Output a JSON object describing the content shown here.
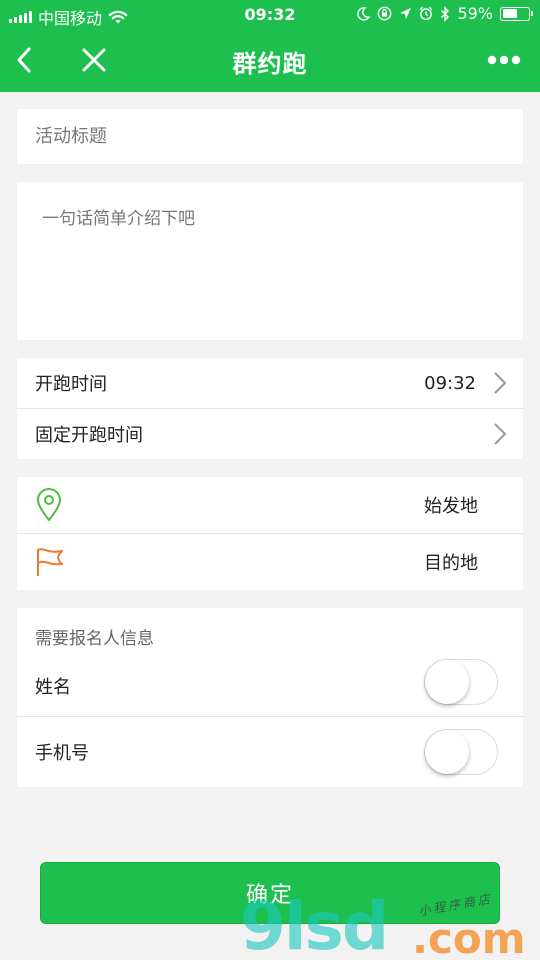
{
  "status_bar": {
    "carrier": "中国移动",
    "time": "09:32",
    "battery_percent": "59%",
    "battery_level": 0.59,
    "icons": [
      "signal-bars",
      "wifi-icon",
      "moon-icon",
      "rotation-lock-icon",
      "location-arrow-icon",
      "alarm-icon",
      "bluetooth-icon",
      "battery-icon"
    ]
  },
  "nav": {
    "title": "群约跑",
    "left_icons": [
      "back-chevron-icon",
      "close-icon"
    ],
    "right_icon": "more-dots-icon"
  },
  "form": {
    "title_placeholder": "活动标题",
    "intro_placeholder": "一句话简单介绍下吧",
    "start_time_label": "开跑时间",
    "start_time_value": "09:32",
    "fixed_time_label": "固定开跑时间",
    "origin_label": "始发地",
    "destination_label": "目的地",
    "info_section_title": "需要报名人信息",
    "name_label": "姓名",
    "name_toggle_on": false,
    "phone_label": "手机号",
    "phone_toggle_on": false,
    "confirm_label": "确定"
  },
  "colors": {
    "brand_green": "#1dc04f",
    "origin_pin": "#4cbd3c",
    "destination_flag": "#ee7a30"
  },
  "watermark": {
    "big_text": "9lsd",
    "com_text": ".com",
    "small_text": "小程序商店"
  }
}
